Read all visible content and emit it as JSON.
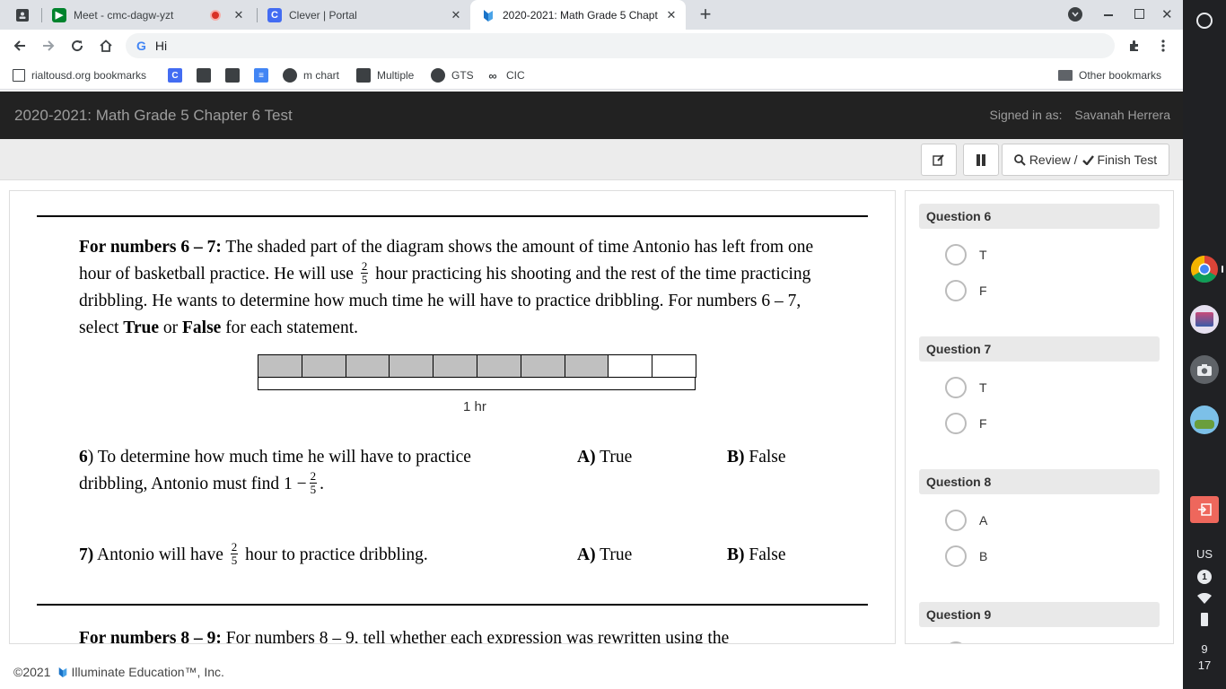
{
  "browser": {
    "tabs": [
      {
        "title": "",
        "icon": "contact-icon"
      },
      {
        "title": "Meet - cmc-dagw-yzt",
        "icon": "meet-icon",
        "recording": true
      },
      {
        "title": "Clever | Portal",
        "icon": "clever-icon"
      },
      {
        "title": "2020-2021: Math Grade 5 Chapt",
        "icon": "illuminate-icon",
        "active": true
      }
    ],
    "omnibox_text": "Hi",
    "bookmarks": [
      {
        "label": "rialtousd.org bookmarks",
        "icon": "page-icon"
      },
      {
        "label": "",
        "icon": "clever-icon"
      },
      {
        "label": "",
        "icon": "contact-icon"
      },
      {
        "label": "",
        "icon": "contact-icon"
      },
      {
        "label": "",
        "icon": "docs-icon"
      },
      {
        "label": "m chart",
        "icon": "globe-icon"
      },
      {
        "label": "Multiple",
        "icon": "contact-icon"
      },
      {
        "label": "GTS",
        "icon": "globe-icon"
      },
      {
        "label": "CIC",
        "icon": "link-icon"
      }
    ],
    "other_bookmarks": "Other bookmarks"
  },
  "app": {
    "title": "2020-2021: Math Grade 5 Chapter 6 Test",
    "signed_in_label": "Signed in as:",
    "user": "Savanah Herrera"
  },
  "testbar": {
    "review_label": "Review /",
    "finish_label": "Finish Test"
  },
  "content": {
    "passage_lead": "For numbers 6 – 7:",
    "passage_1": " The shaded part of the diagram shows the amount of time Antonio has left from one hour of basketball practice. He will use ",
    "passage_2": " hour practicing his shooting and the rest of the time practicing dribbling. He wants to determine how much time he will have to practice dribbling. For numbers 6 – 7, select ",
    "passage_true": "True",
    "passage_or": " or ",
    "passage_false": "False",
    "passage_3": " for each statement.",
    "frac_num": "2",
    "frac_den": "5",
    "diagram": {
      "total_cells": 10,
      "shaded_cells": 8,
      "label": "1 hr"
    },
    "q6_num": "6",
    "q6_text_1": ") To determine how much time he will have to practice dribbling, Antonio must find 1 −",
    "q6_text_2": ".",
    "q7_num": "7)",
    "q7_text_1": " Antonio will have ",
    "q7_text_2": " hour to practice dribbling.",
    "opt_a_letter": "A)",
    "opt_a_text": " True",
    "opt_b_letter": "B)",
    "opt_b_text": " False",
    "next_lead": "For numbers 8 – 9:",
    "next_text": " For numbers 8 – 9, tell whether each expression was rewritten using the"
  },
  "answers": [
    {
      "title": "Question 6",
      "options": [
        "T",
        "F"
      ]
    },
    {
      "title": "Question 7",
      "options": [
        "T",
        "F"
      ]
    },
    {
      "title": "Question 8",
      "options": [
        "A",
        "B"
      ]
    },
    {
      "title": "Question 9",
      "options": []
    }
  ],
  "footer": {
    "copyright": "©2021",
    "company": "Illuminate Education™, Inc."
  },
  "shelf": {
    "locale": "US",
    "notifications": "1",
    "time_hour": "9",
    "time_min": "17"
  },
  "colors": {
    "app_header": "#222222",
    "shaded": "#c0c0c0",
    "shelf": "#202124"
  }
}
